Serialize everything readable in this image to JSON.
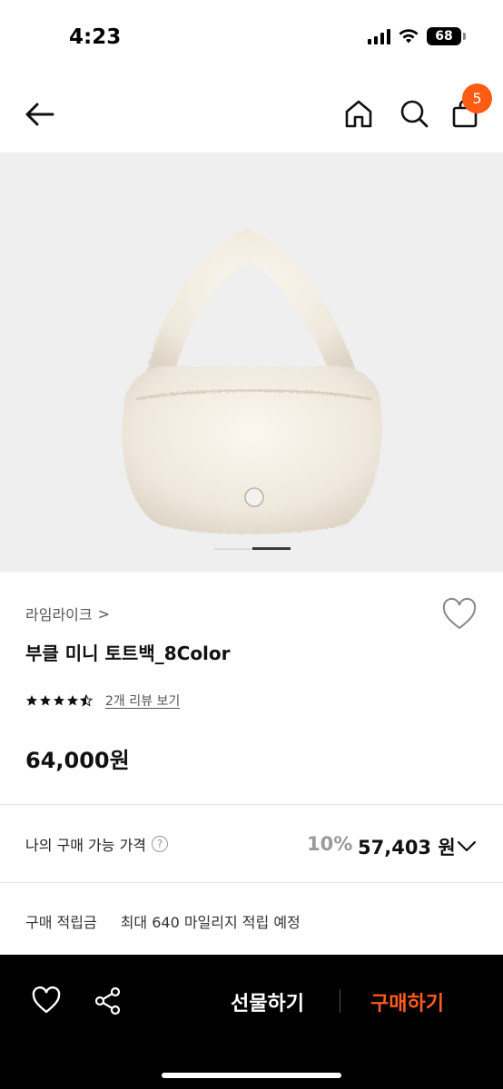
{
  "status_bar": {
    "time": "4:23",
    "battery": "68"
  },
  "nav": {
    "back_icon": "arrow-left-icon",
    "home_icon": "home-icon",
    "search_icon": "search-icon",
    "cart_icon": "cart-icon",
    "cart_count": "5",
    "accent": "#ff5b14"
  },
  "product": {
    "image": "bag-image",
    "brand": "라임라이크",
    "brand_chevron": ">",
    "name": "부클 미니 토트백_8Color",
    "rating": 4.5,
    "review_link": "2개 리뷰 보기",
    "price": "64,000원"
  },
  "my_price": {
    "label": "나의 구매 가능 가격",
    "help": "?",
    "discount": "10%",
    "price": "57,403 원"
  },
  "points": {
    "label": "구매 적립금",
    "value": "최대 640 마일리지 적립 예정"
  },
  "bottom_bar": {
    "gift_label": "선물하기",
    "buy_label": "구매하기",
    "buy_color": "#ff5a1f"
  }
}
